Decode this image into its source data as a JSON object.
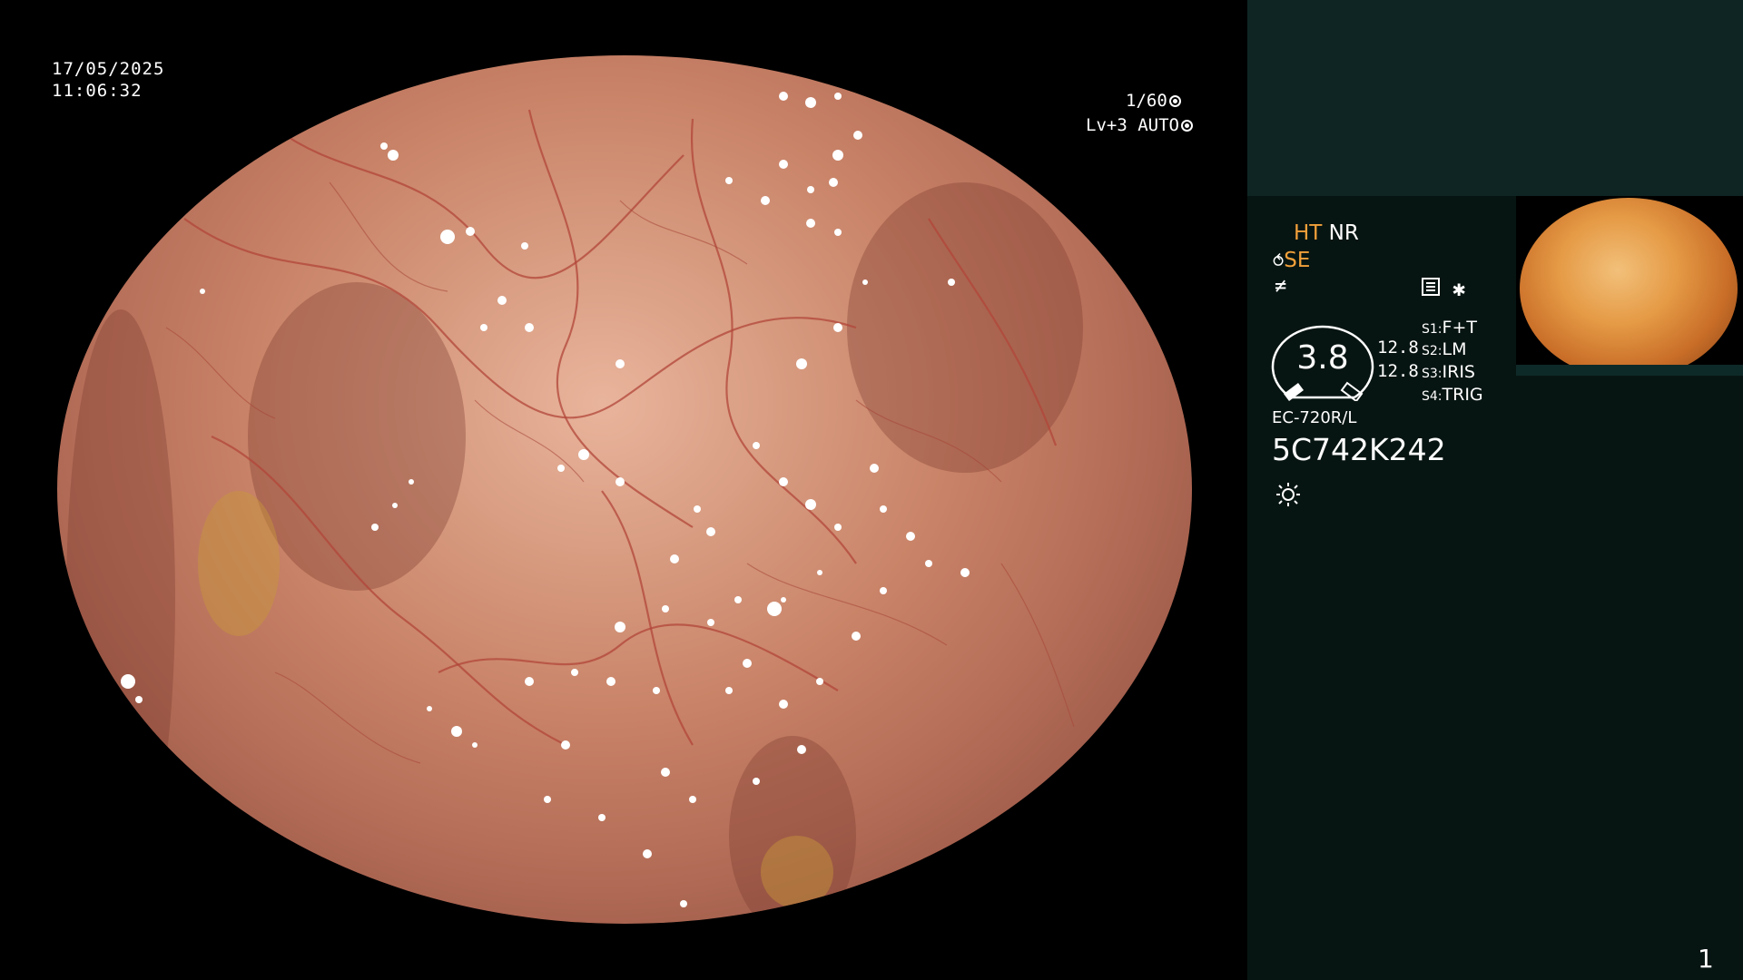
{
  "overlay": {
    "date": "17/05/2025",
    "time": "11:06:32",
    "shutter": "1/60",
    "level_auto": "Lv+3 AUTO"
  },
  "info_panel": {
    "ht": "HT",
    "nr": "NR",
    "se": "SE",
    "gauge_value": "3.8",
    "values": [
      "12.8",
      "12.8"
    ],
    "switches": [
      {
        "key": "S1:",
        "value": "F+T"
      },
      {
        "key": "S2:",
        "value": "LM"
      },
      {
        "key": "S3:",
        "value": "IRIS"
      },
      {
        "key": "S4:",
        "value": "TRIG"
      }
    ],
    "scope_model": "EC-720R/L",
    "scope_serial": "5C742K242"
  },
  "icons": [
    "aperture-icon",
    "iris-icon",
    "air-icon",
    "freeze-icon",
    "menu-icon",
    "asterisk-icon",
    "light-icon"
  ],
  "colors": {
    "accent_orange": "#f2a03a",
    "panel_bg": "#071512",
    "panel_band": "#0e2524"
  },
  "page_number": "1"
}
